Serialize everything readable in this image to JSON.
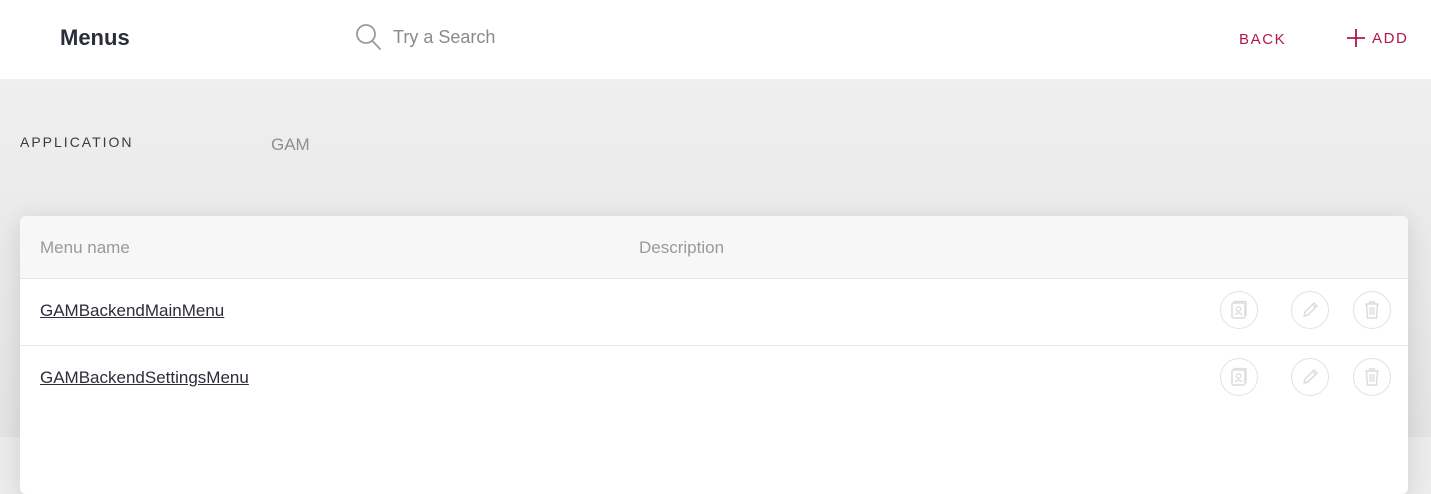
{
  "header": {
    "title": "Menus",
    "search_placeholder": "Try a Search",
    "back_label": "BACK",
    "add_label": "ADD"
  },
  "filter": {
    "label": "APPLICATION",
    "value": "GAM"
  },
  "table": {
    "columns": [
      "Menu name",
      "Description"
    ],
    "rows": [
      {
        "name": "GAMBackendMainMenu",
        "description": ""
      },
      {
        "name": "GAMBackendSettingsMenu",
        "description": ""
      }
    ],
    "actions": [
      "permissions-icon",
      "edit-icon",
      "delete-icon"
    ]
  },
  "colors": {
    "accent": "#b0164f",
    "title": "#2b2d3a",
    "icon_light": "#dcdcdc"
  }
}
